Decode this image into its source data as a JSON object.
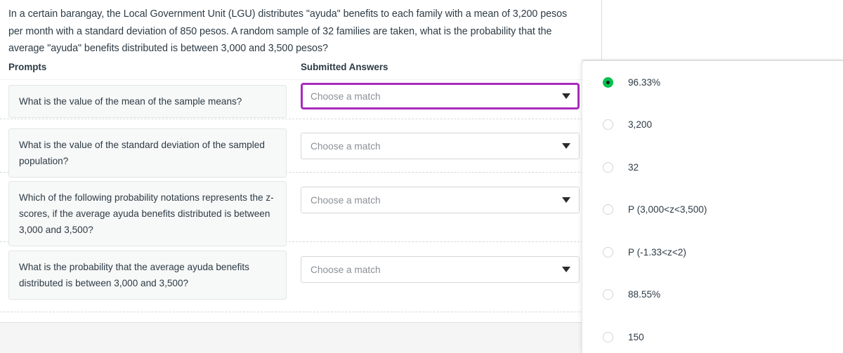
{
  "question": {
    "stem": "In a certain barangay, the Local Government Unit (LGU) distributes \"ayuda\" benefits to each family with a mean of 3,200 pesos per month with a standard deviation of 850 pesos. A random sample of 32 families are taken, what is the probability that the average \"ayuda\" benefits distributed is between 3,000 and 3,500 pesos?"
  },
  "columns": {
    "prompts_header": "Prompts",
    "answers_header": "Submitted Answers"
  },
  "rows": [
    {
      "prompt": "What is the value of the mean of the sample means?",
      "select_value": "Choose a match",
      "focused": true
    },
    {
      "prompt": "What is the value of the standard deviation of the sampled population?",
      "select_value": "Choose a match",
      "focused": false
    },
    {
      "prompt": "Which of the following probability notations represents the z-scores, if the average ayuda benefits distributed is between 3,000 and 3,500?",
      "select_value": "Choose a match",
      "focused": false
    },
    {
      "prompt": "What is the probability that the average ayuda benefits distributed is between 3,000 and 3,500?",
      "select_value": "Choose a match",
      "focused": false
    }
  ],
  "answer_bank": {
    "options": [
      {
        "label": "96.33%",
        "selected": true
      },
      {
        "label": "3,200",
        "selected": false
      },
      {
        "label": "32",
        "selected": false
      },
      {
        "label": "P (3,000<z<3,500)",
        "selected": false
      },
      {
        "label": "P (-1.33<z<2)",
        "selected": false
      },
      {
        "label": "88.55%",
        "selected": false
      },
      {
        "label": "150",
        "selected": false
      }
    ]
  },
  "colors": {
    "focus_purple": "#a92bbd",
    "selected_green": "#06c14e",
    "text": "#2d3b45",
    "placeholder": "#8b9096"
  }
}
